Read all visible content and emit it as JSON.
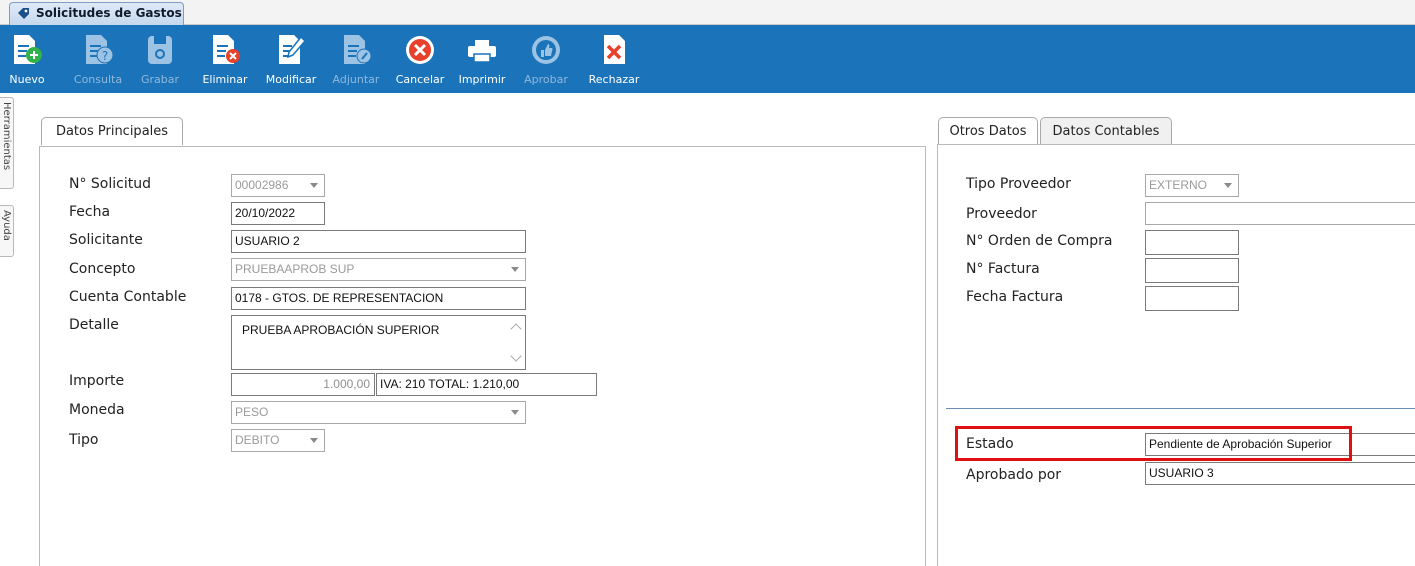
{
  "window": {
    "tab_title": "Solicitudes de Gastos"
  },
  "toolbar": {
    "buttons": [
      {
        "label": "Nuevo",
        "icon": "new-document-icon",
        "enabled": true
      },
      {
        "label": "Consulta",
        "icon": "query-document-icon",
        "enabled": false
      },
      {
        "label": "Grabar",
        "icon": "save-floppy-icon",
        "enabled": false
      },
      {
        "label": "Eliminar",
        "icon": "delete-document-icon",
        "enabled": true
      },
      {
        "label": "Modificar",
        "icon": "edit-document-icon",
        "enabled": true
      },
      {
        "label": "Adjuntar",
        "icon": "attach-document-icon",
        "enabled": false
      },
      {
        "label": "Cancelar",
        "icon": "cancel-circle-icon",
        "enabled": true
      },
      {
        "label": "Imprimir",
        "icon": "printer-icon",
        "enabled": true
      },
      {
        "label": "Aprobar",
        "icon": "approve-thumb-icon",
        "enabled": false
      },
      {
        "label": "Rechazar",
        "icon": "reject-document-icon",
        "enabled": true
      }
    ]
  },
  "side_tabs": [
    "Herramientas",
    "Ayuda"
  ],
  "left_panel": {
    "tab": "Datos Principales",
    "fields": {
      "solicitud": {
        "label": "N° Solicitud",
        "value": "00002986"
      },
      "fecha": {
        "label": "Fecha",
        "value": "20/10/2022"
      },
      "solicitante": {
        "label": "Solicitante",
        "value": "USUARIO 2"
      },
      "concepto": {
        "label": "Concepto",
        "value": "PRUEBAAPROB SUP"
      },
      "cuenta": {
        "label": "Cuenta Contable",
        "value": "0178 - GTOS. DE REPRESENTACION"
      },
      "detalle": {
        "label": "Detalle",
        "value": "PRUEBA APROBACIÓN SUPERIOR"
      },
      "importe": {
        "label": "Importe",
        "value": "1.000,00",
        "summary": "IVA: 210 TOTAL:  1.210,00"
      },
      "moneda": {
        "label": "Moneda",
        "value": "PESO"
      },
      "tipo": {
        "label": "Tipo",
        "value": "DEBITO"
      }
    }
  },
  "right_panel": {
    "tabs": [
      "Otros Datos",
      "Datos Contables"
    ],
    "fields": {
      "tipo_proveedor": {
        "label": "Tipo Proveedor",
        "value": "EXTERNO"
      },
      "proveedor": {
        "label": "Proveedor",
        "value": ""
      },
      "orden_compra": {
        "label": "N° Orden de Compra",
        "value": ""
      },
      "factura": {
        "label": "N° Factura",
        "value": ""
      },
      "fecha_factura": {
        "label": "Fecha Factura",
        "value": ""
      },
      "estado": {
        "label": "Estado",
        "value": "Pendiente de Aprobación Superior"
      },
      "aprobado_por": {
        "label": "Aprobado por",
        "value": "USUARIO 3"
      }
    }
  },
  "colors": {
    "toolbar": "#1b74ba",
    "highlight": "#e01010",
    "disabled_text": "#9a9a9a"
  }
}
